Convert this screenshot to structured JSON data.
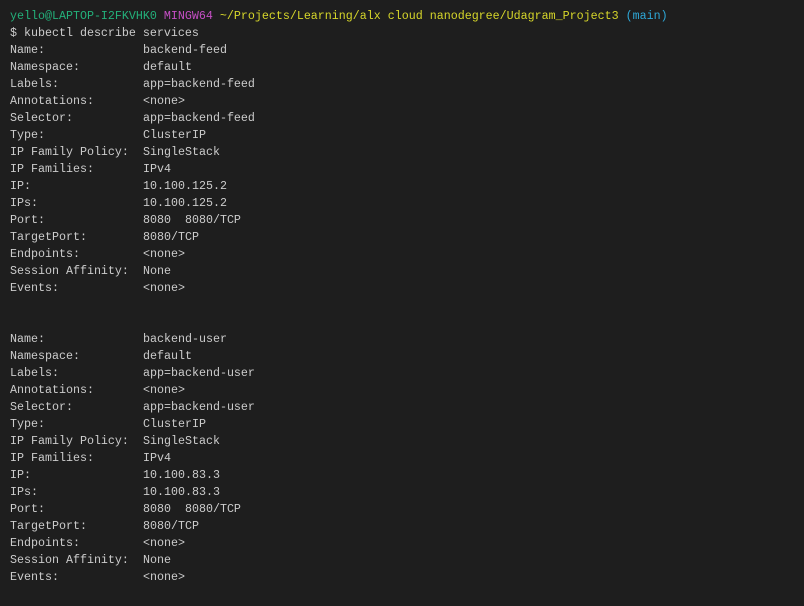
{
  "prompt": {
    "user_host": "yello@LAPTOP-I2FKVHK0",
    "system": "MINGW64",
    "path": "~/Projects/Learning/alx cloud nanodegree/Udagram_Project3",
    "branch": "(main)",
    "command": "$ kubectl describe services"
  },
  "services": [
    {
      "fields": [
        {
          "label": "Name:",
          "value": "backend-feed"
        },
        {
          "label": "Namespace:",
          "value": "default"
        },
        {
          "label": "Labels:",
          "value": "app=backend-feed"
        },
        {
          "label": "Annotations:",
          "value": "<none>"
        },
        {
          "label": "Selector:",
          "value": "app=backend-feed"
        },
        {
          "label": "Type:",
          "value": "ClusterIP"
        },
        {
          "label": "IP Family Policy:",
          "value": "SingleStack"
        },
        {
          "label": "IP Families:",
          "value": "IPv4"
        },
        {
          "label": "IP:",
          "value": "10.100.125.2"
        },
        {
          "label": "IPs:",
          "value": "10.100.125.2"
        },
        {
          "label": "Port:",
          "value": "8080  8080/TCP"
        },
        {
          "label": "TargetPort:",
          "value": "8080/TCP"
        },
        {
          "label": "Endpoints:",
          "value": "<none>"
        },
        {
          "label": "Session Affinity:",
          "value": "None"
        },
        {
          "label": "Events:",
          "value": "<none>"
        }
      ]
    },
    {
      "fields": [
        {
          "label": "Name:",
          "value": "backend-user"
        },
        {
          "label": "Namespace:",
          "value": "default"
        },
        {
          "label": "Labels:",
          "value": "app=backend-user"
        },
        {
          "label": "Annotations:",
          "value": "<none>"
        },
        {
          "label": "Selector:",
          "value": "app=backend-user"
        },
        {
          "label": "Type:",
          "value": "ClusterIP"
        },
        {
          "label": "IP Family Policy:",
          "value": "SingleStack"
        },
        {
          "label": "IP Families:",
          "value": "IPv4"
        },
        {
          "label": "IP:",
          "value": "10.100.83.3"
        },
        {
          "label": "IPs:",
          "value": "10.100.83.3"
        },
        {
          "label": "Port:",
          "value": "8080  8080/TCP"
        },
        {
          "label": "TargetPort:",
          "value": "8080/TCP"
        },
        {
          "label": "Endpoints:",
          "value": "<none>"
        },
        {
          "label": "Session Affinity:",
          "value": "None"
        },
        {
          "label": "Events:",
          "value": "<none>"
        }
      ]
    }
  ]
}
